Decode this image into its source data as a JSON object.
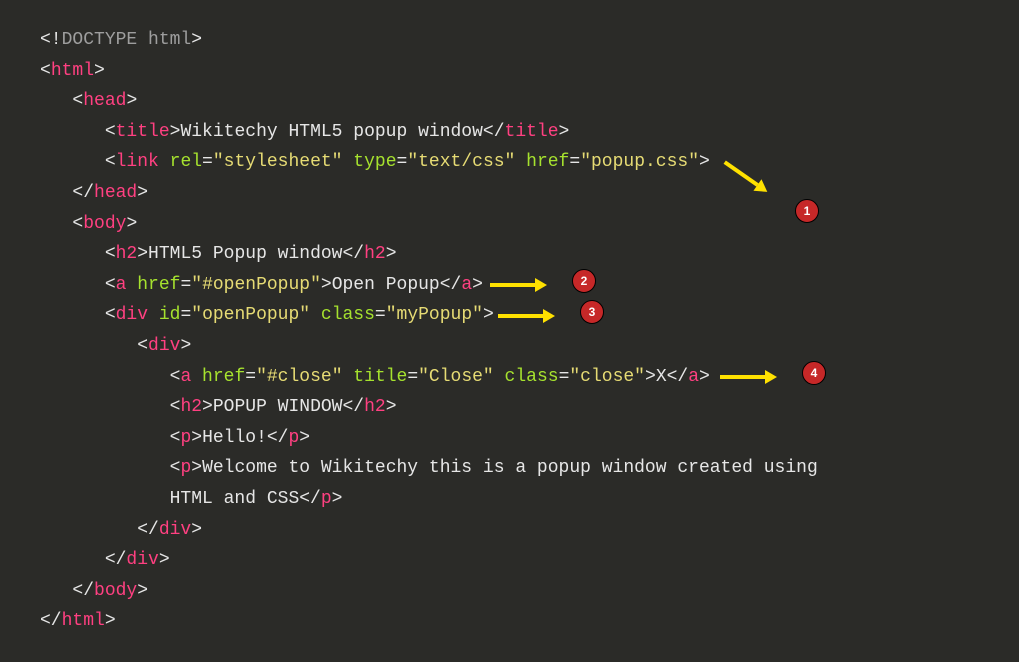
{
  "code": {
    "line1": {
      "lt": "<!",
      "tag": "DOCTYPE ",
      "attr": "html",
      "gt": ">"
    },
    "line2": {
      "open": "<",
      "tag": "html",
      "close": ">"
    },
    "line3": {
      "open": "<",
      "tag": "head",
      "close": ">"
    },
    "line4": {
      "open": "<",
      "tag": "title",
      "close": ">",
      "text": "Wikitechy HTML5 popup window",
      "open2": "</",
      "tag2": "title",
      "close2": ">"
    },
    "line5": {
      "open": "<",
      "tag": "link ",
      "a1": "rel",
      "eq1": "=",
      "v1": "\"stylesheet\" ",
      "a2": "type",
      "eq2": "=",
      "v2": "\"text/css\" ",
      "a3": "href",
      "eq3": "=",
      "v3": "\"popup.css\"",
      "close": ">"
    },
    "line6": {
      "open": "</",
      "tag": "head",
      "close": ">"
    },
    "line7": {
      "open": "<",
      "tag": "body",
      "close": ">"
    },
    "line8": {
      "open": "<",
      "tag": "h2",
      "close": ">",
      "text": "HTML5 Popup window",
      "open2": "</",
      "tag2": "h2",
      "close2": ">"
    },
    "line9": {
      "open": "<",
      "tag": "a ",
      "a1": "href",
      "eq1": "=",
      "v1": "\"#openPopup\"",
      "close": ">",
      "text": "Open Popup",
      "open2": "</",
      "tag2": "a",
      "close2": ">"
    },
    "line10": {
      "open": "<",
      "tag": "div ",
      "a1": "id",
      "eq1": "=",
      "v1": "\"openPopup\" ",
      "a2": "class",
      "eq2": "=",
      "v2": "\"myPopup\"",
      "close": ">"
    },
    "line11": {
      "open": "<",
      "tag": "div",
      "close": ">"
    },
    "line12": {
      "open": "<",
      "tag": "a ",
      "a1": "href",
      "eq1": "=",
      "v1": "\"#close\" ",
      "a2": "title",
      "eq2": "=",
      "v2": "\"Close\" ",
      "a3": "class",
      "eq3": "=",
      "v3": "\"close\"",
      "close": ">",
      "text": "X",
      "open2": "</",
      "tag2": "a",
      "close2": ">"
    },
    "line13": {
      "open": "<",
      "tag": "h2",
      "close": ">",
      "text": "POPUP WINDOW",
      "open2": "</",
      "tag2": "h2",
      "close2": ">"
    },
    "line14": {
      "open": "<",
      "tag": "p",
      "close": ">",
      "text": "Hello!",
      "open2": "</",
      "tag2": "p",
      "close2": ">"
    },
    "line15": {
      "open": "<",
      "tag": "p",
      "close": ">",
      "text": "Welcome to Wikitechy this is a popup window created using",
      "text2": "HTML and CSS",
      "open2": "</",
      "tag2": "p",
      "close2": ">"
    },
    "line16": {
      "open": "</",
      "tag": "div",
      "close": ">"
    },
    "line17": {
      "open": "</",
      "tag": "div",
      "close": ">"
    },
    "line18": {
      "open": "</",
      "tag": "body",
      "close": ">"
    },
    "line19": {
      "open": "</",
      "tag": "html",
      "close": ">"
    }
  },
  "annotations": {
    "a1": "1",
    "a2": "2",
    "a3": "3",
    "a4": "4"
  }
}
